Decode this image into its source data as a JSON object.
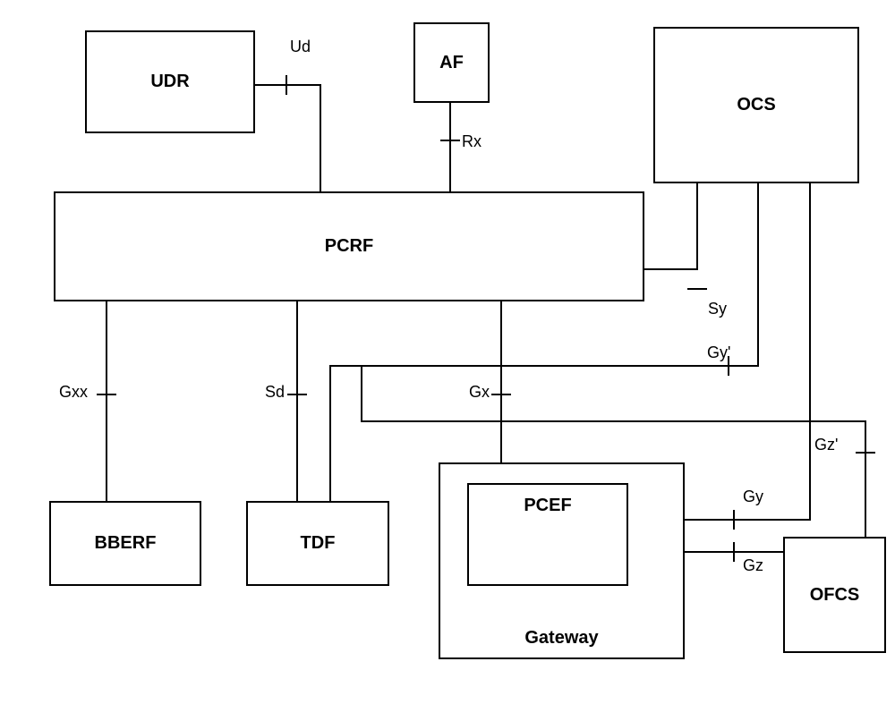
{
  "nodes": {
    "udr": "UDR",
    "af": "AF",
    "ocs": "OCS",
    "pcrf": "PCRF",
    "bberf": "BBERF",
    "tdf": "TDF",
    "pcef": "PCEF",
    "gateway": "Gateway",
    "ofcs": "OFCS"
  },
  "interfaces": {
    "ud": "Ud",
    "rx": "Rx",
    "sy": "Sy",
    "gxx": "Gxx",
    "sd": "Sd",
    "gx": "Gx",
    "gy_prime": "Gy'",
    "gz_prime": "Gz'",
    "gy": "Gy",
    "gz": "Gz"
  }
}
